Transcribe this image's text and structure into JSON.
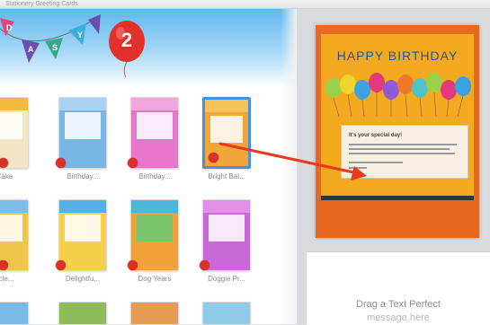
{
  "window": {
    "title": "Stationery Greeting Cards"
  },
  "banner": {
    "bunting_letters": [
      "D",
      "A",
      "S",
      "Y"
    ],
    "balloon_number": "2"
  },
  "gallery": {
    "rows": [
      [
        "Cake",
        "Birthday...",
        "Birthday...",
        "Bright Bal..."
      ],
      [
        "Circle...",
        "Delightfu...",
        "Dog Years",
        "Doggie Pr..."
      ]
    ],
    "selected": "Bright Bal..."
  },
  "preview": {
    "title": "HAPPY BIRTHDAY",
    "message_heading": "It's your special day!"
  },
  "drop_zone": {
    "title": "Drag a Text Perfect",
    "subtitle": "message here"
  },
  "colors": {
    "accent_arrow": "#e83a1c",
    "preview_background": "#e8681f",
    "selection": "#4b8fe0"
  }
}
